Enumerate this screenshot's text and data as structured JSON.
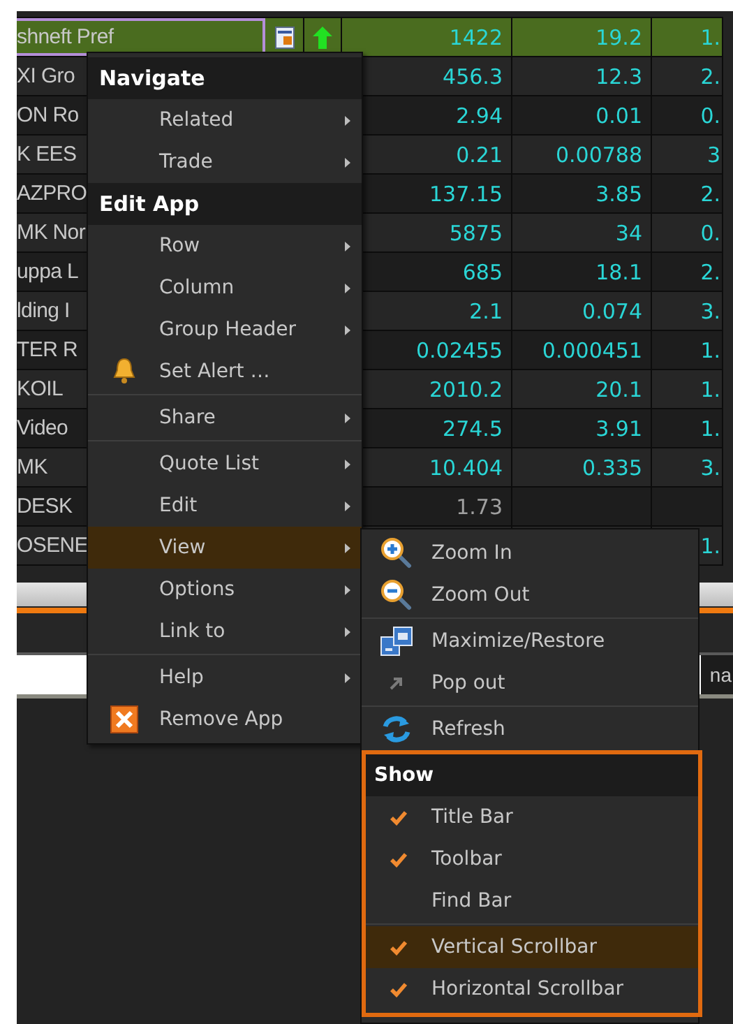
{
  "grid": {
    "rows": [
      {
        "name": "shneft Pref",
        "selected": true,
        "muted": false,
        "cells": {
          "column_1": "1422",
          "column_2": "19.2",
          "column_3": "1."
        }
      },
      {
        "name": "XI Gro",
        "selected": false,
        "muted": false,
        "cells": {
          "column_1": "456.3",
          "column_2": "12.3",
          "column_3": "2."
        }
      },
      {
        "name": "ON Ro",
        "selected": false,
        "muted": false,
        "cells": {
          "column_1": "2.94",
          "column_2": "0.01",
          "column_3": "0."
        }
      },
      {
        "name": "K EES",
        "selected": false,
        "muted": false,
        "cells": {
          "column_1": "0.21",
          "column_2": "0.00788",
          "column_3": "3"
        }
      },
      {
        "name": "AZPRO",
        "selected": false,
        "muted": false,
        "cells": {
          "column_1": "137.15",
          "column_2": "3.85",
          "column_3": "2."
        }
      },
      {
        "name": "MK Nor",
        "selected": false,
        "muted": false,
        "cells": {
          "column_1": "5875",
          "column_2": "34",
          "column_3": "0."
        }
      },
      {
        "name": "uppa L",
        "selected": false,
        "muted": false,
        "cells": {
          "column_1": "685",
          "column_2": "18.1",
          "column_3": "2."
        }
      },
      {
        "name": "lding I",
        "selected": false,
        "muted": false,
        "cells": {
          "column_1": "2.1",
          "column_2": "0.074",
          "column_3": "3."
        }
      },
      {
        "name": "TER R",
        "selected": false,
        "muted": false,
        "cells": {
          "column_1": "0.02455",
          "column_2": "0.000451",
          "column_3": "1."
        }
      },
      {
        "name": "KOIL",
        "selected": false,
        "muted": false,
        "cells": {
          "column_1": "2010.2",
          "column_2": "20.1",
          "column_3": "1."
        }
      },
      {
        "name": "Video",
        "selected": false,
        "muted": false,
        "cells": {
          "column_1": "274.5",
          "column_2": "3.91",
          "column_3": "1."
        }
      },
      {
        "name": "MK",
        "selected": false,
        "muted": false,
        "cells": {
          "column_1": "10.404",
          "column_2": "0.335",
          "column_3": "3."
        }
      },
      {
        "name": "DESK",
        "selected": false,
        "muted": true,
        "cells": {
          "column_1": "1.73"
        }
      },
      {
        "name": "OSENE",
        "selected": false,
        "muted": false,
        "cells": {
          "column_3": "1."
        }
      }
    ]
  },
  "panel": {
    "tab_text": "na"
  },
  "context_menu": {
    "entries": [
      {
        "kind": "header",
        "label": "Navigate"
      },
      {
        "kind": "item",
        "label": "Related",
        "submenu": true,
        "selected": false
      },
      {
        "kind": "item",
        "label": "Trade",
        "submenu": true,
        "selected": false
      },
      {
        "kind": "header",
        "label": "Edit App"
      },
      {
        "kind": "item",
        "label": "Row",
        "submenu": true,
        "selected": false
      },
      {
        "kind": "item",
        "label": "Column",
        "submenu": true,
        "selected": false
      },
      {
        "kind": "item",
        "label": "Group Header",
        "submenu": true,
        "selected": false
      },
      {
        "kind": "alert",
        "label": "Set Alert …",
        "submenu": false,
        "selected": false
      },
      {
        "kind": "separator"
      },
      {
        "kind": "item",
        "label": "Share",
        "submenu": true,
        "selected": false
      },
      {
        "kind": "separator"
      },
      {
        "kind": "item",
        "label": "Quote List",
        "submenu": true,
        "selected": false
      },
      {
        "kind": "item",
        "label": "Edit",
        "submenu": true,
        "selected": false
      },
      {
        "kind": "item",
        "label": "View",
        "submenu": true,
        "selected": true
      },
      {
        "kind": "item",
        "label": "Options",
        "submenu": true,
        "selected": false
      },
      {
        "kind": "item",
        "label": "Link to",
        "submenu": true,
        "selected": false
      },
      {
        "kind": "separator"
      },
      {
        "kind": "item",
        "label": "Help",
        "submenu": true,
        "selected": false
      },
      {
        "kind": "remove",
        "label": "Remove App",
        "submenu": false,
        "selected": false
      }
    ]
  },
  "view_submenu": {
    "entries": [
      {
        "kind": "zoom_in",
        "label": "Zoom In",
        "selected": false
      },
      {
        "kind": "zoom_out",
        "label": "Zoom Out",
        "selected": false
      },
      {
        "kind": "separator"
      },
      {
        "kind": "maximize",
        "label": "Maximize/Restore",
        "selected": false
      },
      {
        "kind": "pop_out",
        "label": "Pop out",
        "selected": false
      },
      {
        "kind": "separator"
      },
      {
        "kind": "refresh",
        "label": "Refresh",
        "selected": false
      }
    ],
    "show_section": {
      "header": "Show",
      "entries": [
        {
          "kind": "check",
          "label": "Title Bar",
          "checked": true,
          "selected": false
        },
        {
          "kind": "check",
          "label": "Toolbar",
          "checked": true,
          "selected": false
        },
        {
          "kind": "check",
          "label": "Find Bar",
          "checked": false,
          "selected": false
        },
        {
          "kind": "separator"
        },
        {
          "kind": "check",
          "label": "Vertical Scrollbar",
          "checked": true,
          "selected": true
        },
        {
          "kind": "check",
          "label": "Horizontal Scrollbar",
          "checked": true,
          "selected": false
        }
      ]
    }
  }
}
